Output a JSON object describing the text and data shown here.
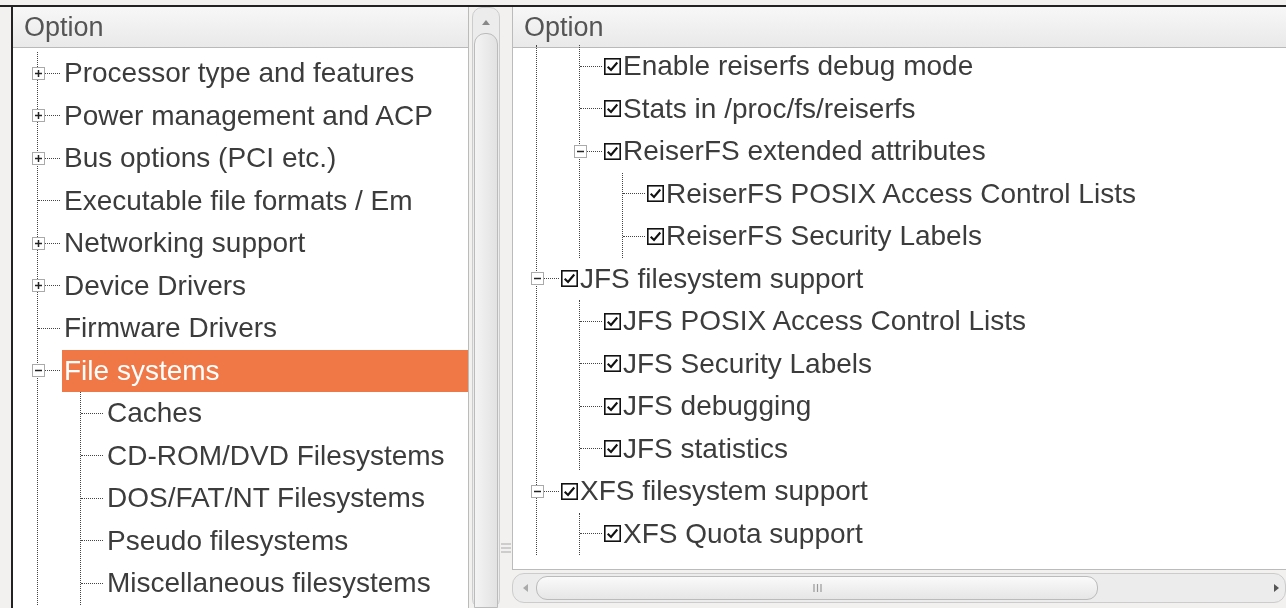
{
  "left_panel": {
    "header": "Option",
    "items": [
      {
        "label": "Processor type and features",
        "expanded": false,
        "selected": false
      },
      {
        "label": "Power management and ACP",
        "expanded": false,
        "selected": false
      },
      {
        "label": "Bus options (PCI etc.)",
        "expanded": false,
        "selected": false
      },
      {
        "label": "Executable file formats / Em",
        "selected": false
      },
      {
        "label": "Networking support",
        "expanded": false,
        "selected": false
      },
      {
        "label": "Device Drivers",
        "expanded": false,
        "selected": false
      },
      {
        "label": "Firmware Drivers",
        "selected": false
      },
      {
        "label": "File systems",
        "expanded": true,
        "selected": true,
        "children": [
          {
            "label": "Caches",
            "selected": false
          },
          {
            "label": "CD-ROM/DVD Filesystems",
            "selected": false
          },
          {
            "label": "DOS/FAT/NT Filesystems",
            "selected": false
          },
          {
            "label": "Pseudo filesystems",
            "selected": false
          },
          {
            "label": "Miscellaneous filesystems",
            "selected": false
          }
        ]
      }
    ]
  },
  "right_panel": {
    "header": "Option",
    "items": [
      {
        "children": [
          {
            "label": "Enable reiserfs debug mode",
            "checked": true
          },
          {
            "label": "Stats in /proc/fs/reiserfs",
            "checked": true
          },
          {
            "label": "ReiserFS extended attributes",
            "checked": true,
            "expanded": true,
            "children": [
              {
                "label": "ReiserFS POSIX Access Control Lists",
                "checked": true
              },
              {
                "label": "ReiserFS Security Labels",
                "checked": true
              }
            ]
          }
        ]
      },
      {
        "label": "JFS filesystem support",
        "checked": true,
        "expanded": true,
        "children": [
          {
            "label": "JFS POSIX Access Control Lists",
            "checked": true
          },
          {
            "label": "JFS Security Labels",
            "checked": true
          },
          {
            "label": "JFS debugging",
            "checked": true
          },
          {
            "label": "JFS statistics",
            "checked": true
          }
        ]
      },
      {
        "label": "XFS filesystem support",
        "checked": true,
        "expanded": true,
        "children": [
          {
            "label": "XFS Quota support",
            "checked": true
          }
        ]
      }
    ]
  }
}
